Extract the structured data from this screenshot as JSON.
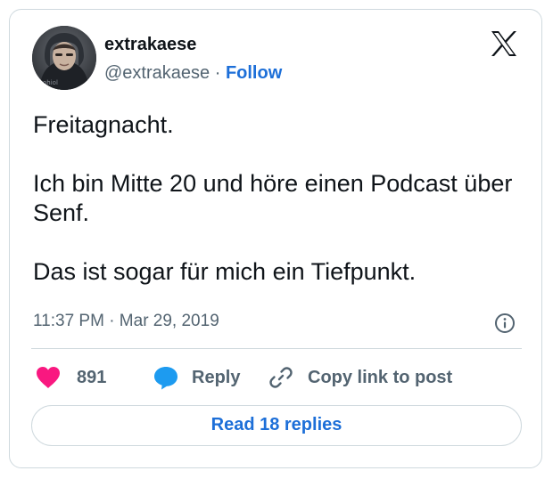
{
  "author": {
    "name": "extrakaese",
    "handle": "@extrakaese",
    "separator": "·",
    "follow_label": "Follow"
  },
  "platform_icon": "x-logo-icon",
  "tweet": {
    "lines": [
      "Freitagnacht.",
      "Ich bin Mitte 20 und höre einen Podcast über Senf.",
      "Das ist sogar für mich ein Tiefpunkt."
    ],
    "timestamp": "11:37 PM · Mar 29, 2019"
  },
  "actions": {
    "likes_count": "891",
    "reply_label": "Reply",
    "copy_label": "Copy link to post"
  },
  "read_replies_label": "Read 18 replies",
  "colors": {
    "accent": "#1d6fd8",
    "heart": "#f91880",
    "reply_bubble": "#1d9bf0",
    "border": "#cfd9de",
    "muted_text": "#536471"
  }
}
